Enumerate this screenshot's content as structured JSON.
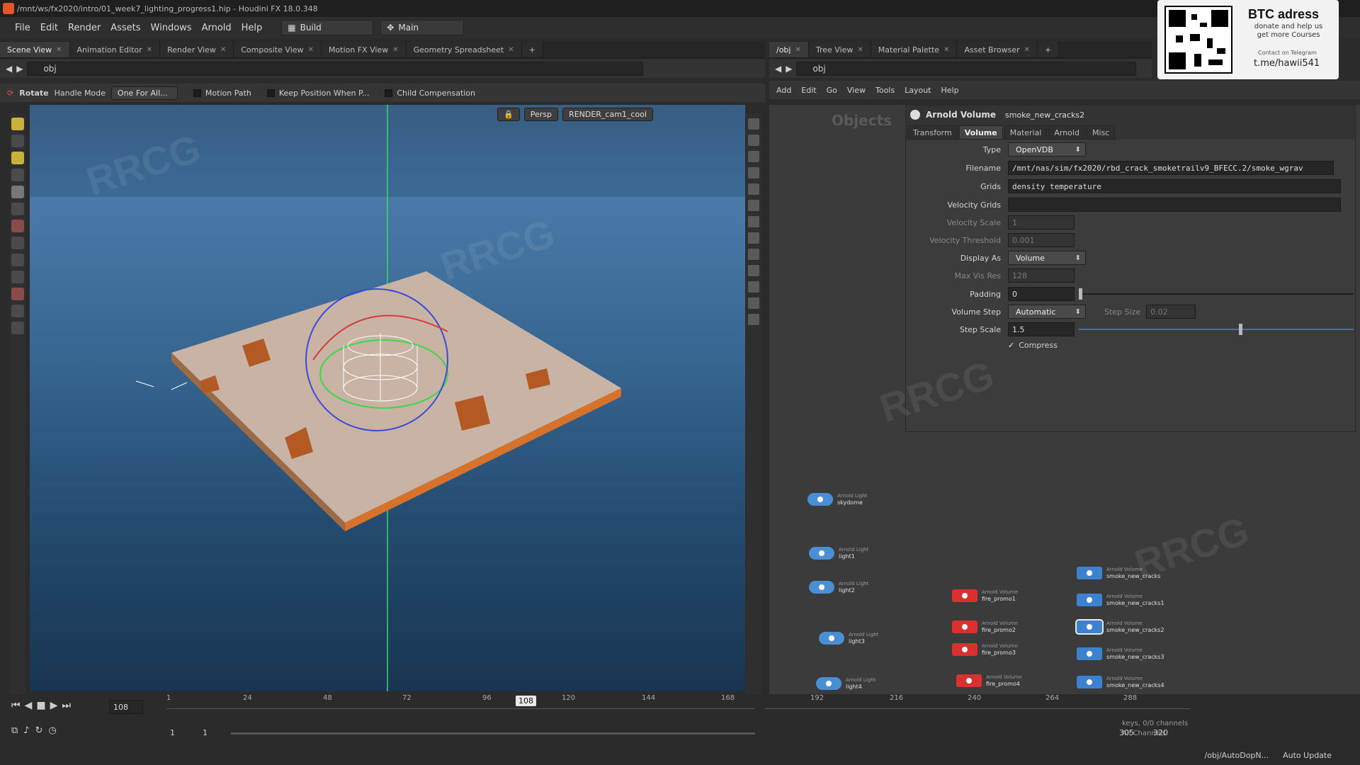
{
  "window": {
    "title": "/mnt/ws/fx2020/intro/01_week7_lighting_progress1.hip - Houdini FX 18.0.348",
    "watermark_corner": "RRCG"
  },
  "menubar": {
    "items": [
      "File",
      "Edit",
      "Render",
      "Assets",
      "Windows",
      "Arnold",
      "Help"
    ],
    "desktop": "Build",
    "workspace": "Main"
  },
  "promo": {
    "title": "BTC adress",
    "subtitle": "donate and help us get more Courses",
    "contact": "Contact on Telegram",
    "handle": "t.me/hawii541"
  },
  "left_tabs": [
    "Scene View",
    "Animation Editor",
    "Render View",
    "Composite View",
    "Motion FX View",
    "Geometry Spreadsheet"
  ],
  "left_path": "obj",
  "tool_options": {
    "tool": "Rotate",
    "handle_mode_label": "Handle Mode",
    "handle_mode_value": "One For All...",
    "motion_path": "Motion Path",
    "keep_position": "Keep Position When P...",
    "child_comp": "Child Compensation"
  },
  "viewport": {
    "camera_mode": "Persp",
    "render_cam": "RENDER_cam1_cool"
  },
  "right_tabs": [
    "/obj",
    "Tree View",
    "Material Palette",
    "Asset Browser"
  ],
  "right_path": "obj",
  "net_menu": [
    "Add",
    "Edit",
    "Go",
    "View",
    "Tools",
    "Layout",
    "Help"
  ],
  "net_label": "Objects",
  "params": {
    "node_type": "Arnold Volume",
    "node_name": "smoke_new_cracks2",
    "tabs": [
      "Transform",
      "Volume",
      "Material",
      "Arnold",
      "Misc"
    ],
    "active_tab": "Volume",
    "type_label": "Type",
    "type_value": "OpenVDB",
    "filename_label": "Filename",
    "filename_value": "/mnt/nas/sim/fx2020/rbd_crack_smoketrailv9_BFECC.2/smoke_wgrav",
    "grids_label": "Grids",
    "grids_value": "density temperature",
    "velgrids_label": "Velocity Grids",
    "velscale_label": "Velocity Scale",
    "velscale_value": "1",
    "velthresh_label": "Velocity Threshold",
    "velthresh_value": "0.001",
    "display_label": "Display As",
    "display_value": "Volume",
    "maxvis_label": "Max Vis Res",
    "maxvis_value": "128",
    "padding_label": "Padding",
    "padding_value": "0",
    "volstep_label": "Volume Step",
    "volstep_value": "Automatic",
    "stepsize_label": "Step Size",
    "stepsize_value": "0.02",
    "stepscale_label": "Step Scale",
    "stepscale_value": "1.5",
    "compress_label": "Compress"
  },
  "nodes": [
    {
      "type": "Arnold Light",
      "name": "skydome",
      "kind": "light"
    },
    {
      "type": "Arnold Light",
      "name": "light1",
      "kind": "light"
    },
    {
      "type": "Arnold Light",
      "name": "light2",
      "kind": "light"
    },
    {
      "type": "Arnold Light",
      "name": "light3",
      "kind": "light"
    },
    {
      "type": "Arnold Light",
      "name": "light4",
      "kind": "light"
    },
    {
      "type": "Arnold Volume",
      "name": "fire_promo1",
      "kind": "fire"
    },
    {
      "type": "Arnold Volume",
      "name": "fire_promo2",
      "kind": "fire"
    },
    {
      "type": "Arnold Volume",
      "name": "fire_promo3",
      "kind": "fire"
    },
    {
      "type": "Arnold Volume",
      "name": "fire_promo4",
      "kind": "fire"
    },
    {
      "type": "Arnold Volume",
      "name": "smoke_new_cracks",
      "kind": "vol"
    },
    {
      "type": "Arnold Volume",
      "name": "smoke_new_cracks1",
      "kind": "vol"
    },
    {
      "type": "Arnold Volume",
      "name": "smoke_new_cracks2",
      "kind": "vol"
    },
    {
      "type": "Arnold Volume",
      "name": "smoke_new_cracks3",
      "kind": "vol"
    },
    {
      "type": "Arnold Volume",
      "name": "smoke_new_cracks4",
      "kind": "vol"
    }
  ],
  "timeline": {
    "current_frame": "108",
    "ticks": [
      "1",
      "24",
      "48",
      "72",
      "96",
      "120",
      "144",
      "168",
      "192",
      "216",
      "240",
      "264",
      "288"
    ],
    "marker": "108",
    "range_start": "1",
    "range_start2": "1",
    "range_end": "305",
    "range_end2": "320"
  },
  "status": {
    "path": "/obj/AutoDopN...",
    "update": "Auto Update",
    "keys": "keys, 0/0 channels",
    "all_channels": "All Channels"
  }
}
